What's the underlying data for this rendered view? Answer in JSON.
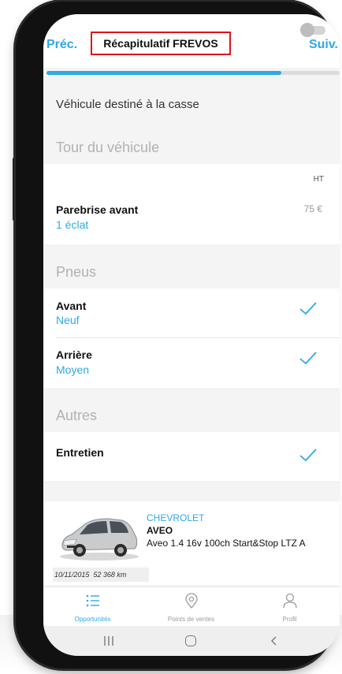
{
  "navbar": {
    "prev_label": "Préc.",
    "title": "Récapitulatif FREVOS",
    "next_label": "Suiv."
  },
  "progress": {
    "value": 0.8
  },
  "casse": {
    "label": "Véhicule destiné à la casse",
    "enabled": false
  },
  "sections": {
    "tour": {
      "title": "Tour du véhicule",
      "price_header": "HT",
      "items": [
        {
          "title": "Parebrise avant",
          "subtitle": "1 éclat",
          "price": "75 €"
        }
      ]
    },
    "pneus": {
      "title": "Pneus",
      "items": [
        {
          "title": "Avant",
          "subtitle": "Neuf",
          "checked": true
        },
        {
          "title": "Arrière",
          "subtitle": "Moyen",
          "checked": true
        }
      ]
    },
    "autres": {
      "title": "Autres",
      "items": [
        {
          "title": "Entretien",
          "checked": true
        }
      ]
    }
  },
  "car": {
    "brand": "CHEVROLET",
    "model": "AVEO",
    "version": "Aveo 1.4 16v 100ch Start&Stop LTZ A",
    "date": "10/11/2015",
    "mileage": "52 368 km"
  },
  "tabbar": {
    "tabs": [
      {
        "label": "Opportunités",
        "icon": "list-icon",
        "active": true
      },
      {
        "label": "Points de ventes",
        "icon": "map-pin-icon",
        "active": false
      },
      {
        "label": "Profil",
        "icon": "user-icon",
        "active": false
      }
    ]
  },
  "system_nav": {
    "icons": [
      "recent-apps-icon",
      "home-icon",
      "back-icon"
    ]
  },
  "colors": {
    "accent": "#2ea9e8",
    "highlight_border": "#e0121b"
  }
}
